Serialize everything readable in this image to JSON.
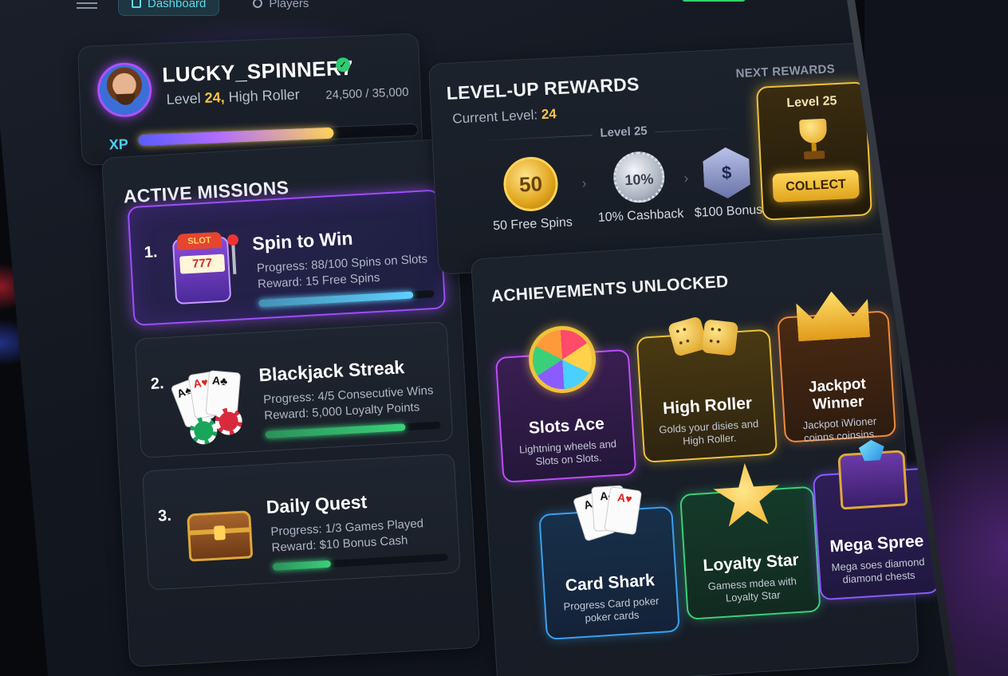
{
  "nav": {
    "tabs": [
      {
        "label": "Dashboard",
        "icon": "grid-icon",
        "active": true
      },
      {
        "label": "Players",
        "icon": "user-icon",
        "active": false
      }
    ]
  },
  "profile": {
    "username": "LUCKY_SPINNER7",
    "level_prefix": "Level",
    "level": "24,",
    "rank": "High Roller",
    "xp_text": "24,500 / 35,000",
    "xp_label": "XP",
    "xp_current": 24500,
    "xp_max": 35000,
    "avatar_icon": "avatar-bearded-man",
    "verified_icon": "check-badge-icon"
  },
  "missions": {
    "title": "ACTIVE MISSIONS",
    "items": [
      {
        "num": "1.",
        "name": "Spin to Win",
        "progress": "Progress: 88/100 Spins on Slots",
        "reward": "Reward: 15 Free Spins",
        "fraction": 0.88,
        "color": "#5fd0ff",
        "icon": "slot-machine-icon"
      },
      {
        "num": "2.",
        "name": "Blackjack Streak",
        "progress": "Progress: 4/5 Consecutive Wins",
        "reward": "Reward: 5,000 Loyalty Points",
        "fraction": 0.8,
        "color": "#3ad07a",
        "icon": "playing-cards-icon"
      },
      {
        "num": "3.",
        "name": "Daily Quest",
        "progress": "Progress: 1/3 Games Played",
        "reward": "Reward: $10 Bonus Cash",
        "fraction": 0.33,
        "color": "#3ad07a",
        "icon": "treasure-chest-icon"
      }
    ]
  },
  "rewards": {
    "title": "LEVEL-UP REWARDS",
    "next_label": "NEXT REWARDS",
    "current_prefix": "Current Level:",
    "current_level": "24",
    "divider_label": "Level 25",
    "items": [
      {
        "art": "50",
        "label": "50 Free Spins",
        "icon": "gold-coin-icon"
      },
      {
        "art": "10%",
        "label": "10% Cashback",
        "icon": "silver-seal-icon"
      },
      {
        "art": "$",
        "label": "$100 Bonus",
        "icon": "dollar-badge-icon"
      }
    ],
    "next_card": {
      "level": "Level 25",
      "button": "COLLECT",
      "icon": "trophy-icon"
    }
  },
  "achievements": {
    "title": "ACHIEVEMENTS UNLOCKED",
    "items": [
      {
        "name": "Slots Ace",
        "desc": "Lightning wheels and Slots on Slots.",
        "icon": "lightning-wheel-icon"
      },
      {
        "name": "High Roller",
        "desc": "Golds your disies and High Roller.",
        "icon": "dice-icon"
      },
      {
        "name": "Jackpot Winner",
        "desc": "Jackpot iWioner coinns coinsins.",
        "icon": "crown-icon"
      },
      {
        "name": "Card Shark",
        "desc": "Progress Card poker poker cards",
        "icon": "playing-cards-icon"
      },
      {
        "name": "Loyalty Star",
        "desc": "Gamess mdea with Loyalty Star",
        "icon": "star-icon"
      },
      {
        "name": "Mega Spree",
        "desc": "Mega soes diamond diamond chests",
        "icon": "gem-chest-icon"
      }
    ]
  }
}
